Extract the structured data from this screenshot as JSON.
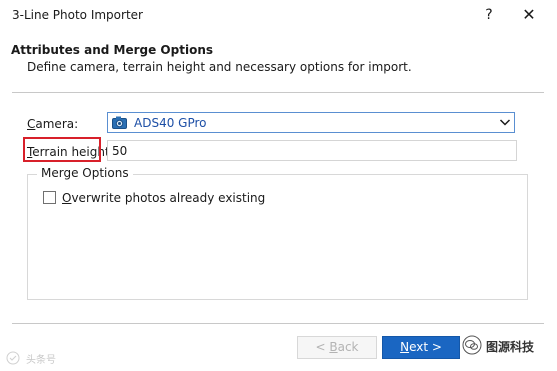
{
  "window": {
    "title": "3-Line Photo Importer",
    "help_label": "?",
    "close_label": "✕"
  },
  "header": {
    "title": "Attributes and Merge Options",
    "subtitle": "Define camera, terrain height and necessary options for import."
  },
  "form": {
    "camera": {
      "label_mnemonic": "C",
      "label_rest": "amera:",
      "selected": "ADS40 GPro",
      "icon": "camera-icon"
    },
    "terrain": {
      "label_mnemonic": "T",
      "label_rest": "errain height:",
      "value": "50"
    },
    "merge_options": {
      "title": "Merge Options",
      "overwrite": {
        "label_mnemonic": "O",
        "label_rest": "verwrite photos already existing",
        "checked": false
      }
    }
  },
  "buttons": {
    "back_prefix": "< ",
    "back_mnemonic": "B",
    "back_rest": "ack",
    "next_mnemonic": "N",
    "next_rest": "ext >"
  },
  "watermarks": {
    "right_text": "图源科技",
    "left_text": "头条号"
  },
  "colors": {
    "highlight_border": "#d8202a",
    "primary_button": "#1a66c2",
    "select_border": "#5a8fd1",
    "select_text": "#1d4fa6"
  }
}
